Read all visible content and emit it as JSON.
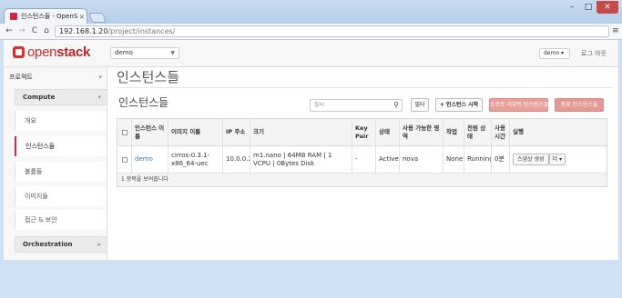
{
  "browser": {
    "tab_title": "인스턴스들 - OpenStack",
    "tab_close": "×",
    "url_host": "192.168.1.20",
    "url_path": "/project/instances/",
    "back": "←",
    "forward": "→",
    "reload": "C",
    "home": "⌂",
    "menu": "≡",
    "win_min": "–",
    "win_max": "□",
    "win_close": "✕"
  },
  "header": {
    "logo_open": "open",
    "logo_stack": "stack",
    "project_select": "demo",
    "project_caret": "▼",
    "user_label": "demo",
    "user_icon": "user-icon",
    "logout_label": "로그 아웃"
  },
  "sidebar": {
    "project_label": "프로젝트",
    "compute_label": "Compute",
    "items": [
      {
        "label": "개요"
      },
      {
        "label": "인스턴스들"
      },
      {
        "label": "볼륨들"
      },
      {
        "label": "이미지들"
      },
      {
        "label": "접근 & 보안"
      }
    ],
    "orchestration_label": "Orchestration"
  },
  "main": {
    "page_title": "인스턴스들",
    "table_title": "인스턴스들",
    "filter_placeholder": "필터",
    "filter_button": "필터",
    "launch_button": "+ 인스턴스 시작",
    "soft_reboot_button": "소프트 리부트 인스턴스들",
    "terminate_button": "종료 인스턴스들",
    "columns": [
      "인스턴스 이름",
      "이미지 이름",
      "IP 주소",
      "크기",
      "Key Pair",
      "상태",
      "사용 가능한 영역",
      "작업",
      "전원 상태",
      "사용 시간",
      "실행"
    ],
    "rows": [
      {
        "name": "demo",
        "image": "cirros-0.3.1-x86_64-uec",
        "ip": "10.0.0.2",
        "size": "m1.nano | 64MB RAM | 1 VCPU | 0Bytes Disk",
        "keypair": "-",
        "status": "Active",
        "zone": "nova",
        "task": "None",
        "power": "Running",
        "uptime": "0분",
        "snapshot_button": "스냅샷 생성",
        "more_button": "더 ▾"
      }
    ],
    "footer": "1 항목을 보여줍니다"
  },
  "colors": {
    "accent": "#d0283f",
    "link": "#3b7dc4",
    "danger_button": "#e39894"
  }
}
